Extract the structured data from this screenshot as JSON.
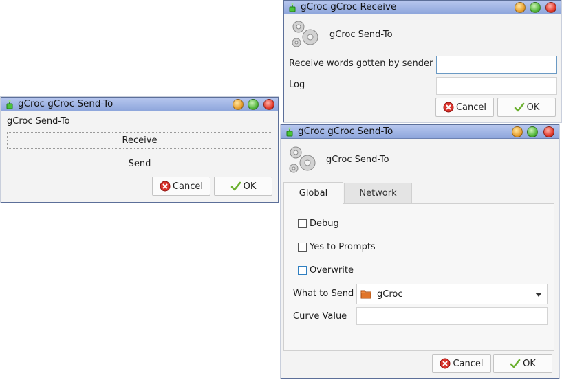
{
  "colors": {
    "titlebar_top": "#b7c7ee",
    "titlebar_bottom": "#8ea6dc",
    "window_bg": "#f3f3f3",
    "cancel_icon": "#d9322b",
    "ok_icon": "#6bb02f",
    "folder_icon": "#e0742a"
  },
  "send_to_small": {
    "title": "gCroc gCroc Send-To",
    "heading": "gCroc Send-To",
    "receive_label": "Receive",
    "send_label": "Send",
    "cancel_label": "Cancel",
    "ok_label": "OK"
  },
  "receive_window": {
    "title": "gCroc gCroc Receive",
    "heading": "gCroc Send-To",
    "words_label": "Receive words gotten by sender",
    "words_value": "",
    "log_label": "Log",
    "log_value": "",
    "cancel_label": "Cancel",
    "ok_label": "OK"
  },
  "send_to_large": {
    "title": "gCroc gCroc Send-To",
    "heading": "gCroc Send-To",
    "tabs": [
      {
        "label": "Global",
        "active": true
      },
      {
        "label": "Network",
        "active": false
      }
    ],
    "debug_label": "Debug",
    "debug_checked": false,
    "yes_label": "Yes to Prompts",
    "yes_checked": false,
    "overwrite_label": "Overwrite",
    "overwrite_checked": false,
    "what_label": "What to Send",
    "what_value": "gCroc",
    "what_icon": "folder-icon",
    "curve_label": "Curve Value",
    "curve_value": "",
    "cancel_label": "Cancel",
    "ok_label": "OK"
  }
}
